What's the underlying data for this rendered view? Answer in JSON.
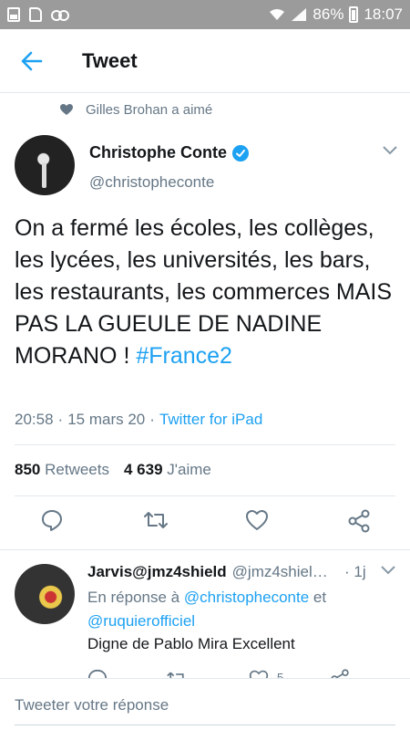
{
  "status_bar": {
    "battery": "86%",
    "time": "18:07"
  },
  "header": {
    "title": "Tweet"
  },
  "social_context": {
    "text": "Gilles Brohan a aimé"
  },
  "tweet": {
    "author_name": "Christophe Conte",
    "author_handle": "@christopheconte",
    "text_plain": "On a fermé les écoles, les collèges, les lycées, les universités, les bars, les restaurants, les commerces MAIS PAS LA GUEULE DE NADINE MORANO ! ",
    "hashtag": "#France2",
    "time": "20:58",
    "date": "15 mars 20",
    "source": "Twitter for iPad",
    "retweets_count": "850",
    "retweets_label": "Retweets",
    "likes_count": "4 639",
    "likes_label": "J'aime"
  },
  "reply": {
    "author_name": "Jarvis@jmz4shield",
    "author_handle": "@jmz4shiel…",
    "time": "· 1j",
    "reply_prefix": "En réponse à",
    "mention1": "@christopheconte",
    "conj": "et",
    "mention2": "@ruquierofficiel",
    "text": "Digne de Pablo Mira Excellent",
    "likes": "5"
  },
  "compose": {
    "placeholder": "Tweeter votre réponse"
  },
  "colors": {
    "accent": "#1da1f2",
    "muted": "#657786",
    "status_bar": "#9b9b9b"
  }
}
